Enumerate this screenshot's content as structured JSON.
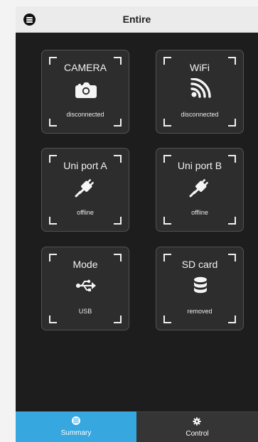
{
  "header": {
    "title": "Entire",
    "menu_icon": "menu-icon"
  },
  "tiles": [
    {
      "label": "CAMERA",
      "status": "disconnected",
      "icon": "camera-icon"
    },
    {
      "label": "WiFi",
      "status": "disconnected",
      "icon": "wifi-icon"
    },
    {
      "label": "Uni port A",
      "status": "offline",
      "icon": "plug-icon"
    },
    {
      "label": "Uni port B",
      "status": "offline",
      "icon": "plug-icon"
    },
    {
      "label": "Mode",
      "status": "USB",
      "icon": "usb-icon"
    },
    {
      "label": "SD card",
      "status": "removed",
      "icon": "database-icon"
    }
  ],
  "bottom_nav": {
    "tabs": [
      {
        "label": "Summary",
        "icon": "grid-icon",
        "active": true
      },
      {
        "label": "Control",
        "icon": "gear-icon",
        "active": false
      }
    ]
  },
  "colors": {
    "active_tab": "#37a7df",
    "background": "#1d1d1d",
    "tile_background": "#2d2d2d"
  }
}
